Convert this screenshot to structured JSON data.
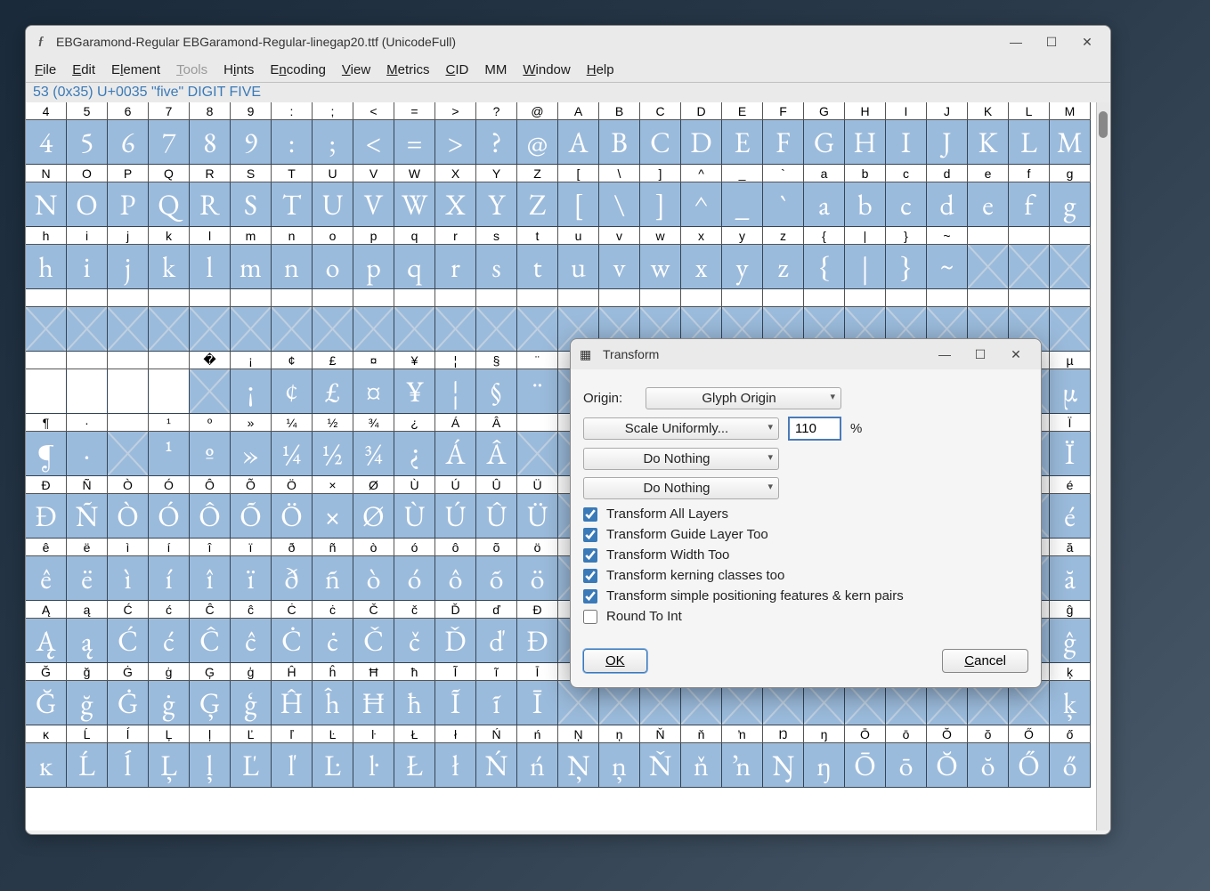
{
  "window": {
    "title": "EBGaramond-Regular  EBGaramond-Regular-linegap20.ttf (UnicodeFull)"
  },
  "menu": {
    "file": "File",
    "edit": "Edit",
    "element": "Element",
    "tools": "Tools",
    "hints": "Hints",
    "encoding": "Encoding",
    "view": "View",
    "metrics": "Metrics",
    "cid": "CID",
    "mm": "MM",
    "window": "Window",
    "help": "Help"
  },
  "status": "53 (0x35) U+0035 \"five\" DIGIT FIVE",
  "glyph_rows": [
    {
      "heads": [
        "4",
        "5",
        "6",
        "7",
        "8",
        "9",
        ":",
        ";",
        "<",
        "=",
        ">",
        "?",
        "@",
        "A",
        "B",
        "C",
        "D",
        "E",
        "F",
        "G",
        "H",
        "I",
        "J",
        "K",
        "L",
        "M"
      ],
      "glyphs": [
        "4",
        "5",
        "6",
        "7",
        "8",
        "9",
        ":",
        ";",
        "<",
        "=",
        ">",
        "?",
        "@",
        "A",
        "B",
        "C",
        "D",
        "E",
        "F",
        "G",
        "H",
        "I",
        "J",
        "K",
        "L",
        "M"
      ]
    },
    {
      "heads": [
        "N",
        "O",
        "P",
        "Q",
        "R",
        "S",
        "T",
        "U",
        "V",
        "W",
        "X",
        "Y",
        "Z",
        "[",
        "\\",
        "]",
        "^",
        "_",
        "`",
        "a",
        "b",
        "c",
        "d",
        "e",
        "f",
        "g"
      ],
      "glyphs": [
        "N",
        "O",
        "P",
        "Q",
        "R",
        "S",
        "T",
        "U",
        "V",
        "W",
        "X",
        "Y",
        "Z",
        "[",
        "\\",
        "]",
        "^",
        "_",
        "`",
        "a",
        "b",
        "c",
        "d",
        "e",
        "f",
        "g"
      ]
    },
    {
      "heads": [
        "h",
        "i",
        "j",
        "k",
        "l",
        "m",
        "n",
        "o",
        "p",
        "q",
        "r",
        "s",
        "t",
        "u",
        "v",
        "w",
        "x",
        "y",
        "z",
        "{",
        "|",
        "}",
        "~",
        "",
        "",
        ""
      ],
      "glyphs": [
        "h",
        "i",
        "j",
        "k",
        "l",
        "m",
        "n",
        "o",
        "p",
        "q",
        "r",
        "s",
        "t",
        "u",
        "v",
        "w",
        "x",
        "y",
        "z",
        "{",
        "|",
        "}",
        "~",
        "",
        "",
        ""
      ]
    },
    {
      "heads": [
        "",
        "",
        "",
        "",
        "",
        "",
        "",
        "",
        "",
        "",
        "",
        "",
        "",
        "",
        "",
        "",
        "",
        "",
        "",
        "",
        "",
        "",
        "",
        "",
        "",
        ""
      ],
      "glyphs": [
        "",
        "",
        "",
        "",
        "",
        "",
        "",
        "",
        "",
        "",
        "",
        "",
        "",
        "",
        "",
        "",
        "",
        "",
        "",
        "",
        "",
        "",
        "",
        "",
        "",
        ""
      ]
    },
    {
      "heads": [
        "",
        "",
        "",
        "",
        "�",
        "¡",
        "¢",
        "£",
        "¤",
        "¥",
        "¦",
        "§",
        "¨",
        "",
        "",
        "",
        "",
        "",
        "",
        "",
        "",
        "",
        "",
        "",
        "",
        "µ"
      ],
      "glyphs": [
        "",
        "",
        "",
        "",
        "",
        "¡",
        "¢",
        "£",
        "¤",
        "¥",
        "¦",
        "§",
        "¨",
        "",
        "",
        "",
        "",
        "",
        "",
        "",
        "",
        "",
        "",
        "",
        "",
        "µ"
      ]
    },
    {
      "heads": [
        "¶",
        "·",
        "",
        "¹",
        "º",
        "»",
        "¼",
        "½",
        "¾",
        "¿",
        "Á",
        "Â",
        "",
        "",
        "",
        "",
        "",
        "",
        "",
        "",
        "",
        "",
        "",
        "",
        "",
        "Ï"
      ],
      "glyphs": [
        "¶",
        "·",
        "",
        "¹",
        "º",
        "»",
        "¼",
        "½",
        "¾",
        "¿",
        "Á",
        "Â",
        "",
        "",
        "",
        "",
        "",
        "",
        "",
        "",
        "",
        "",
        "",
        "",
        "",
        "Ï"
      ]
    },
    {
      "heads": [
        "Đ",
        "Ñ",
        "Ò",
        "Ó",
        "Ô",
        "Õ",
        "Ö",
        "×",
        "Ø",
        "Ù",
        "Ú",
        "Û",
        "Ü",
        "",
        "",
        "",
        "",
        "",
        "",
        "",
        "",
        "",
        "",
        "",
        "",
        "é"
      ],
      "glyphs": [
        "Đ",
        "Ñ",
        "Ò",
        "Ó",
        "Ô",
        "Õ",
        "Ö",
        "×",
        "Ø",
        "Ù",
        "Ú",
        "Û",
        "Ü",
        "",
        "",
        "",
        "",
        "",
        "",
        "",
        "",
        "",
        "",
        "",
        "",
        "é"
      ]
    },
    {
      "heads": [
        "ê",
        "ë",
        "ì",
        "í",
        "î",
        "ï",
        "ð",
        "ñ",
        "ò",
        "ó",
        "ô",
        "õ",
        "ö",
        "",
        "",
        "",
        "",
        "",
        "",
        "",
        "",
        "",
        "",
        "",
        "",
        "ă"
      ],
      "glyphs": [
        "ê",
        "ë",
        "ì",
        "í",
        "î",
        "ï",
        "ð",
        "ñ",
        "ò",
        "ó",
        "ô",
        "õ",
        "ö",
        "",
        "",
        "",
        "",
        "",
        "",
        "",
        "",
        "",
        "",
        "",
        "",
        "ă"
      ]
    },
    {
      "heads": [
        "Ą",
        "ą",
        "Ć",
        "ć",
        "Ĉ",
        "ĉ",
        "Ċ",
        "ċ",
        "Č",
        "č",
        "Ď",
        "ď",
        "Đ",
        "",
        "",
        "",
        "",
        "",
        "",
        "",
        "",
        "",
        "",
        "",
        "",
        "ĝ"
      ],
      "glyphs": [
        "Ą",
        "ą",
        "Ć",
        "ć",
        "Ĉ",
        "ĉ",
        "Ċ",
        "ċ",
        "Č",
        "č",
        "Ď",
        "ď",
        "Đ",
        "",
        "",
        "",
        "",
        "",
        "",
        "",
        "",
        "",
        "",
        "",
        "",
        "ĝ"
      ]
    },
    {
      "heads": [
        "Ğ",
        "ğ",
        "Ġ",
        "ġ",
        "Ģ",
        "ģ",
        "Ĥ",
        "ĥ",
        "Ħ",
        "ħ",
        "Ĩ",
        "ĩ",
        "Ī",
        "",
        "",
        "",
        "",
        "",
        "",
        "",
        "",
        "",
        "",
        "",
        "",
        "ķ"
      ],
      "glyphs": [
        "Ğ",
        "ğ",
        "Ġ",
        "ġ",
        "Ģ",
        "ģ",
        "Ĥ",
        "ĥ",
        "Ħ",
        "ħ",
        "Ĩ",
        "ĩ",
        "Ī",
        "",
        "",
        "",
        "",
        "",
        "",
        "",
        "",
        "",
        "",
        "",
        "",
        "ķ"
      ]
    },
    {
      "heads": [
        "ĸ",
        "Ĺ",
        "ĺ",
        "Ļ",
        "ļ",
        "Ľ",
        "ľ",
        "Ŀ",
        "ŀ",
        "Ł",
        "ł",
        "Ń",
        "ń",
        "Ņ",
        "ņ",
        "Ň",
        "ň",
        "ŉ",
        "Ŋ",
        "ŋ",
        "Ō",
        "ō",
        "Ŏ",
        "ŏ",
        "Ő",
        "ő"
      ],
      "glyphs": [
        "ĸ",
        "Ĺ",
        "ĺ",
        "Ļ",
        "ļ",
        "Ľ",
        "ľ",
        "Ŀ",
        "ŀ",
        "Ł",
        "ł",
        "Ń",
        "ń",
        "Ņ",
        "ņ",
        "Ň",
        "ň",
        "ŉ",
        "Ŋ",
        "ŋ",
        "Ō",
        "ō",
        "Ŏ",
        "ŏ",
        "Ő",
        "ő"
      ]
    }
  ],
  "dialog": {
    "title": "Transform",
    "origin_label": "Origin:",
    "origin_value": "Glyph Origin",
    "op1": "Scale Uniformly...",
    "scale_value": "110",
    "percent": "%",
    "op2": "Do Nothing",
    "op3": "Do Nothing",
    "check_all_layers": "Transform All Layers",
    "check_guide": "Transform Guide Layer Too",
    "check_width": "Transform Width Too",
    "check_kerning": "Transform kerning classes too",
    "check_simple": "Transform simple positioning features & kern pairs",
    "check_round": "Round To Int",
    "ok": "OK",
    "cancel": "Cancel"
  }
}
